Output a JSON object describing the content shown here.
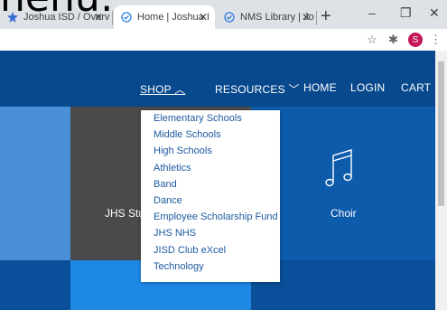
{
  "caption": "nenu:",
  "browser": {
    "tabs": [
      {
        "label": "Joshua ISD / Overvie",
        "icon": "district-logo-icon",
        "active": false
      },
      {
        "label": "Home | Joshua ISD",
        "icon": "check-circle-icon",
        "active": true
      },
      {
        "label": "NMS Library | Joshua",
        "icon": "check-circle-icon",
        "active": false
      }
    ],
    "new_tab": "+",
    "minimize": "–",
    "restore": "❐",
    "close": "✕",
    "profile_initial": "S"
  },
  "nav": {
    "shop": "SHOP",
    "resources": "RESOURCES",
    "home": "HOME",
    "login": "LOGIN",
    "cart": "CART"
  },
  "tiles": {
    "jhs_student": "JHS Stu",
    "choir": "Choir"
  },
  "dropdown": [
    "Elementary Schools",
    "Middle Schools",
    "High Schools",
    "Athletics",
    "Band",
    "Dance",
    "Employee Scholarship Fund",
    "JHS NHS",
    "JISD Club eXcel",
    "Technology"
  ],
  "colors": {
    "header": "#08498d",
    "tile_blue": "#0d5bab",
    "tile_dark": "#4a4a4a",
    "tile_light": "#1e88e5",
    "link": "#1e5aa0"
  }
}
